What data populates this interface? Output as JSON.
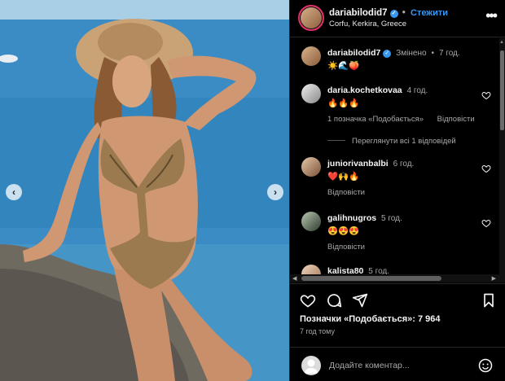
{
  "post": {
    "author": "dariabilodid7",
    "follow_label": "Стежити",
    "location": "Corfu, Kerkira, Greece",
    "more_label": "•••"
  },
  "caption": {
    "author": "dariabilodid7",
    "edited": "Змінено",
    "time": "7 год.",
    "text": "☀️🌊🍑"
  },
  "comments": [
    {
      "user": "daria.kochetkovaa",
      "time": "4 год.",
      "text": "🔥🔥🔥",
      "likes_label": "1 позначка «Подобається»",
      "reply_label": "Відповісти"
    },
    {
      "user": "juniorivanbalbi",
      "time": "6 год.",
      "text": "❤️🙌🔥",
      "reply_label": "Відповісти"
    },
    {
      "user": "galihnugros",
      "time": "5 год.",
      "text": "😍😍😍",
      "reply_label": "Відповісти"
    },
    {
      "user": "kalista80",
      "time": "5 год."
    }
  ],
  "view_replies": "Переглянути всі 1 відповідей",
  "likes": "Позначки «Подобається»: 7 964",
  "posted_ago": "7 год тому",
  "add_comment": {
    "placeholder": "Додайте коментар..."
  },
  "icons": {
    "prev": "‹",
    "next": "›",
    "scroll_left": "◀",
    "scroll_right": "▶",
    "scroll_up": "▲"
  },
  "colors": {
    "accent": "#3897f0",
    "background": "#000000",
    "heart_red": "#ed4956"
  }
}
